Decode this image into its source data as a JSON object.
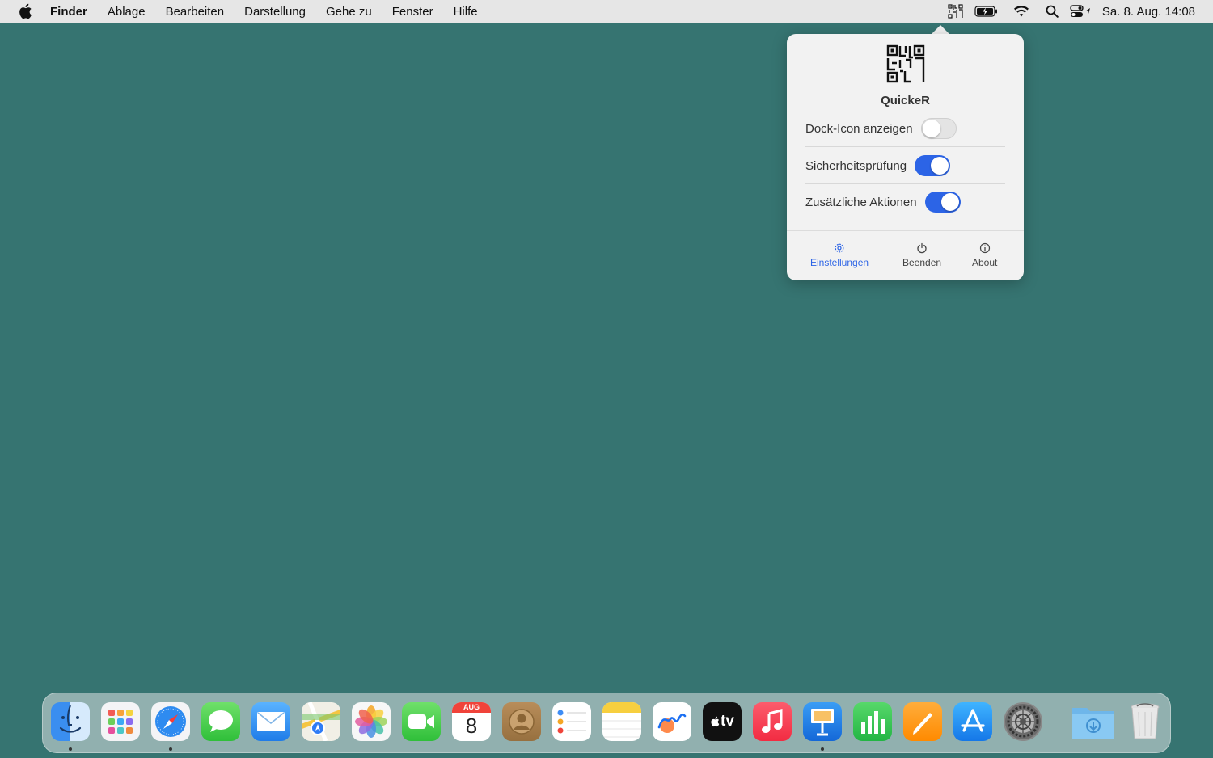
{
  "menubar": {
    "app_name": "Finder",
    "items": [
      "Ablage",
      "Bearbeiten",
      "Darstellung",
      "Gehe zu",
      "Fenster",
      "Hilfe"
    ],
    "clock": "Sa. 8. Aug.  14:08",
    "status_icons": [
      "quicker-icon",
      "battery-icon",
      "wifi-icon",
      "spotlight-icon",
      "control-center-icon"
    ]
  },
  "popover": {
    "app_title": "QuickeR",
    "settings": [
      {
        "label": "Dock-Icon anzeigen",
        "enabled": false
      },
      {
        "label": "Sicherheitsprüfung",
        "enabled": true
      },
      {
        "label": "Zusätzliche Aktionen",
        "enabled": true
      }
    ],
    "footer": {
      "settings_label": "Einstellungen",
      "quit_label": "Beenden",
      "about_label": "About"
    }
  },
  "dock": {
    "apps": [
      {
        "name": "Finder",
        "running": true
      },
      {
        "name": "Launchpad",
        "running": false
      },
      {
        "name": "Safari",
        "running": true
      },
      {
        "name": "Nachrichten",
        "running": false
      },
      {
        "name": "Mail",
        "running": false
      },
      {
        "name": "Karten",
        "running": false
      },
      {
        "name": "Fotos",
        "running": false
      },
      {
        "name": "FaceTime",
        "running": false
      },
      {
        "name": "Kalender",
        "running": false
      },
      {
        "name": "Kontakte",
        "running": false
      },
      {
        "name": "Erinnerungen",
        "running": false
      },
      {
        "name": "Notizen",
        "running": false
      },
      {
        "name": "Freeform",
        "running": false
      },
      {
        "name": "TV",
        "running": false
      },
      {
        "name": "Musik",
        "running": false
      },
      {
        "name": "Keynote",
        "running": true
      },
      {
        "name": "Numbers",
        "running": false
      },
      {
        "name": "Pages",
        "running": false
      },
      {
        "name": "App Store",
        "running": false
      },
      {
        "name": "Systemeinstellungen",
        "running": false
      }
    ],
    "calendar_month": "AUG",
    "calendar_day": "8",
    "tv_label": "tv",
    "downloads": "Downloads",
    "trash": "Papierkorb"
  }
}
